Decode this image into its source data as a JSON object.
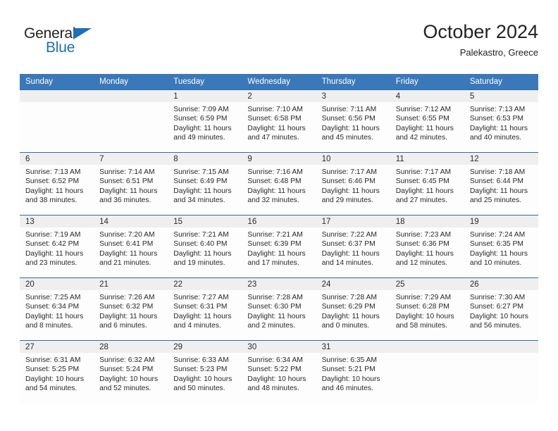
{
  "brand": {
    "line1": "General",
    "line2": "Blue",
    "accent_color": "#1C6FB8",
    "text_color": "#232323"
  },
  "header": {
    "title": "October 2024",
    "subtitle": "Palekastro, Greece"
  },
  "theme": {
    "header_bg": "#3B78B9",
    "row_divider": "#2E6DA9",
    "day_band_bg": "#EFEFEF",
    "text": "#282828"
  },
  "weekdays": [
    "Sunday",
    "Monday",
    "Tuesday",
    "Wednesday",
    "Thursday",
    "Friday",
    "Saturday"
  ],
  "weeks": [
    [
      {
        "date": "",
        "sunrise": "",
        "sunset": "",
        "daylight1": "",
        "daylight2": ""
      },
      {
        "date": "",
        "sunrise": "",
        "sunset": "",
        "daylight1": "",
        "daylight2": ""
      },
      {
        "date": "1",
        "sunrise": "Sunrise: 7:09 AM",
        "sunset": "Sunset: 6:59 PM",
        "daylight1": "Daylight: 11 hours",
        "daylight2": "and 49 minutes."
      },
      {
        "date": "2",
        "sunrise": "Sunrise: 7:10 AM",
        "sunset": "Sunset: 6:58 PM",
        "daylight1": "Daylight: 11 hours",
        "daylight2": "and 47 minutes."
      },
      {
        "date": "3",
        "sunrise": "Sunrise: 7:11 AM",
        "sunset": "Sunset: 6:56 PM",
        "daylight1": "Daylight: 11 hours",
        "daylight2": "and 45 minutes."
      },
      {
        "date": "4",
        "sunrise": "Sunrise: 7:12 AM",
        "sunset": "Sunset: 6:55 PM",
        "daylight1": "Daylight: 11 hours",
        "daylight2": "and 42 minutes."
      },
      {
        "date": "5",
        "sunrise": "Sunrise: 7:13 AM",
        "sunset": "Sunset: 6:53 PM",
        "daylight1": "Daylight: 11 hours",
        "daylight2": "and 40 minutes."
      }
    ],
    [
      {
        "date": "6",
        "sunrise": "Sunrise: 7:13 AM",
        "sunset": "Sunset: 6:52 PM",
        "daylight1": "Daylight: 11 hours",
        "daylight2": "and 38 minutes."
      },
      {
        "date": "7",
        "sunrise": "Sunrise: 7:14 AM",
        "sunset": "Sunset: 6:51 PM",
        "daylight1": "Daylight: 11 hours",
        "daylight2": "and 36 minutes."
      },
      {
        "date": "8",
        "sunrise": "Sunrise: 7:15 AM",
        "sunset": "Sunset: 6:49 PM",
        "daylight1": "Daylight: 11 hours",
        "daylight2": "and 34 minutes."
      },
      {
        "date": "9",
        "sunrise": "Sunrise: 7:16 AM",
        "sunset": "Sunset: 6:48 PM",
        "daylight1": "Daylight: 11 hours",
        "daylight2": "and 32 minutes."
      },
      {
        "date": "10",
        "sunrise": "Sunrise: 7:17 AM",
        "sunset": "Sunset: 6:46 PM",
        "daylight1": "Daylight: 11 hours",
        "daylight2": "and 29 minutes."
      },
      {
        "date": "11",
        "sunrise": "Sunrise: 7:17 AM",
        "sunset": "Sunset: 6:45 PM",
        "daylight1": "Daylight: 11 hours",
        "daylight2": "and 27 minutes."
      },
      {
        "date": "12",
        "sunrise": "Sunrise: 7:18 AM",
        "sunset": "Sunset: 6:44 PM",
        "daylight1": "Daylight: 11 hours",
        "daylight2": "and 25 minutes."
      }
    ],
    [
      {
        "date": "13",
        "sunrise": "Sunrise: 7:19 AM",
        "sunset": "Sunset: 6:42 PM",
        "daylight1": "Daylight: 11 hours",
        "daylight2": "and 23 minutes."
      },
      {
        "date": "14",
        "sunrise": "Sunrise: 7:20 AM",
        "sunset": "Sunset: 6:41 PM",
        "daylight1": "Daylight: 11 hours",
        "daylight2": "and 21 minutes."
      },
      {
        "date": "15",
        "sunrise": "Sunrise: 7:21 AM",
        "sunset": "Sunset: 6:40 PM",
        "daylight1": "Daylight: 11 hours",
        "daylight2": "and 19 minutes."
      },
      {
        "date": "16",
        "sunrise": "Sunrise: 7:21 AM",
        "sunset": "Sunset: 6:39 PM",
        "daylight1": "Daylight: 11 hours",
        "daylight2": "and 17 minutes."
      },
      {
        "date": "17",
        "sunrise": "Sunrise: 7:22 AM",
        "sunset": "Sunset: 6:37 PM",
        "daylight1": "Daylight: 11 hours",
        "daylight2": "and 14 minutes."
      },
      {
        "date": "18",
        "sunrise": "Sunrise: 7:23 AM",
        "sunset": "Sunset: 6:36 PM",
        "daylight1": "Daylight: 11 hours",
        "daylight2": "and 12 minutes."
      },
      {
        "date": "19",
        "sunrise": "Sunrise: 7:24 AM",
        "sunset": "Sunset: 6:35 PM",
        "daylight1": "Daylight: 11 hours",
        "daylight2": "and 10 minutes."
      }
    ],
    [
      {
        "date": "20",
        "sunrise": "Sunrise: 7:25 AM",
        "sunset": "Sunset: 6:34 PM",
        "daylight1": "Daylight: 11 hours",
        "daylight2": "and 8 minutes."
      },
      {
        "date": "21",
        "sunrise": "Sunrise: 7:26 AM",
        "sunset": "Sunset: 6:32 PM",
        "daylight1": "Daylight: 11 hours",
        "daylight2": "and 6 minutes."
      },
      {
        "date": "22",
        "sunrise": "Sunrise: 7:27 AM",
        "sunset": "Sunset: 6:31 PM",
        "daylight1": "Daylight: 11 hours",
        "daylight2": "and 4 minutes."
      },
      {
        "date": "23",
        "sunrise": "Sunrise: 7:28 AM",
        "sunset": "Sunset: 6:30 PM",
        "daylight1": "Daylight: 11 hours",
        "daylight2": "and 2 minutes."
      },
      {
        "date": "24",
        "sunrise": "Sunrise: 7:28 AM",
        "sunset": "Sunset: 6:29 PM",
        "daylight1": "Daylight: 11 hours",
        "daylight2": "and 0 minutes."
      },
      {
        "date": "25",
        "sunrise": "Sunrise: 7:29 AM",
        "sunset": "Sunset: 6:28 PM",
        "daylight1": "Daylight: 10 hours",
        "daylight2": "and 58 minutes."
      },
      {
        "date": "26",
        "sunrise": "Sunrise: 7:30 AM",
        "sunset": "Sunset: 6:27 PM",
        "daylight1": "Daylight: 10 hours",
        "daylight2": "and 56 minutes."
      }
    ],
    [
      {
        "date": "27",
        "sunrise": "Sunrise: 6:31 AM",
        "sunset": "Sunset: 5:25 PM",
        "daylight1": "Daylight: 10 hours",
        "daylight2": "and 54 minutes."
      },
      {
        "date": "28",
        "sunrise": "Sunrise: 6:32 AM",
        "sunset": "Sunset: 5:24 PM",
        "daylight1": "Daylight: 10 hours",
        "daylight2": "and 52 minutes."
      },
      {
        "date": "29",
        "sunrise": "Sunrise: 6:33 AM",
        "sunset": "Sunset: 5:23 PM",
        "daylight1": "Daylight: 10 hours",
        "daylight2": "and 50 minutes."
      },
      {
        "date": "30",
        "sunrise": "Sunrise: 6:34 AM",
        "sunset": "Sunset: 5:22 PM",
        "daylight1": "Daylight: 10 hours",
        "daylight2": "and 48 minutes."
      },
      {
        "date": "31",
        "sunrise": "Sunrise: 6:35 AM",
        "sunset": "Sunset: 5:21 PM",
        "daylight1": "Daylight: 10 hours",
        "daylight2": "and 46 minutes."
      },
      {
        "date": "",
        "sunrise": "",
        "sunset": "",
        "daylight1": "",
        "daylight2": ""
      },
      {
        "date": "",
        "sunrise": "",
        "sunset": "",
        "daylight1": "",
        "daylight2": ""
      }
    ]
  ]
}
